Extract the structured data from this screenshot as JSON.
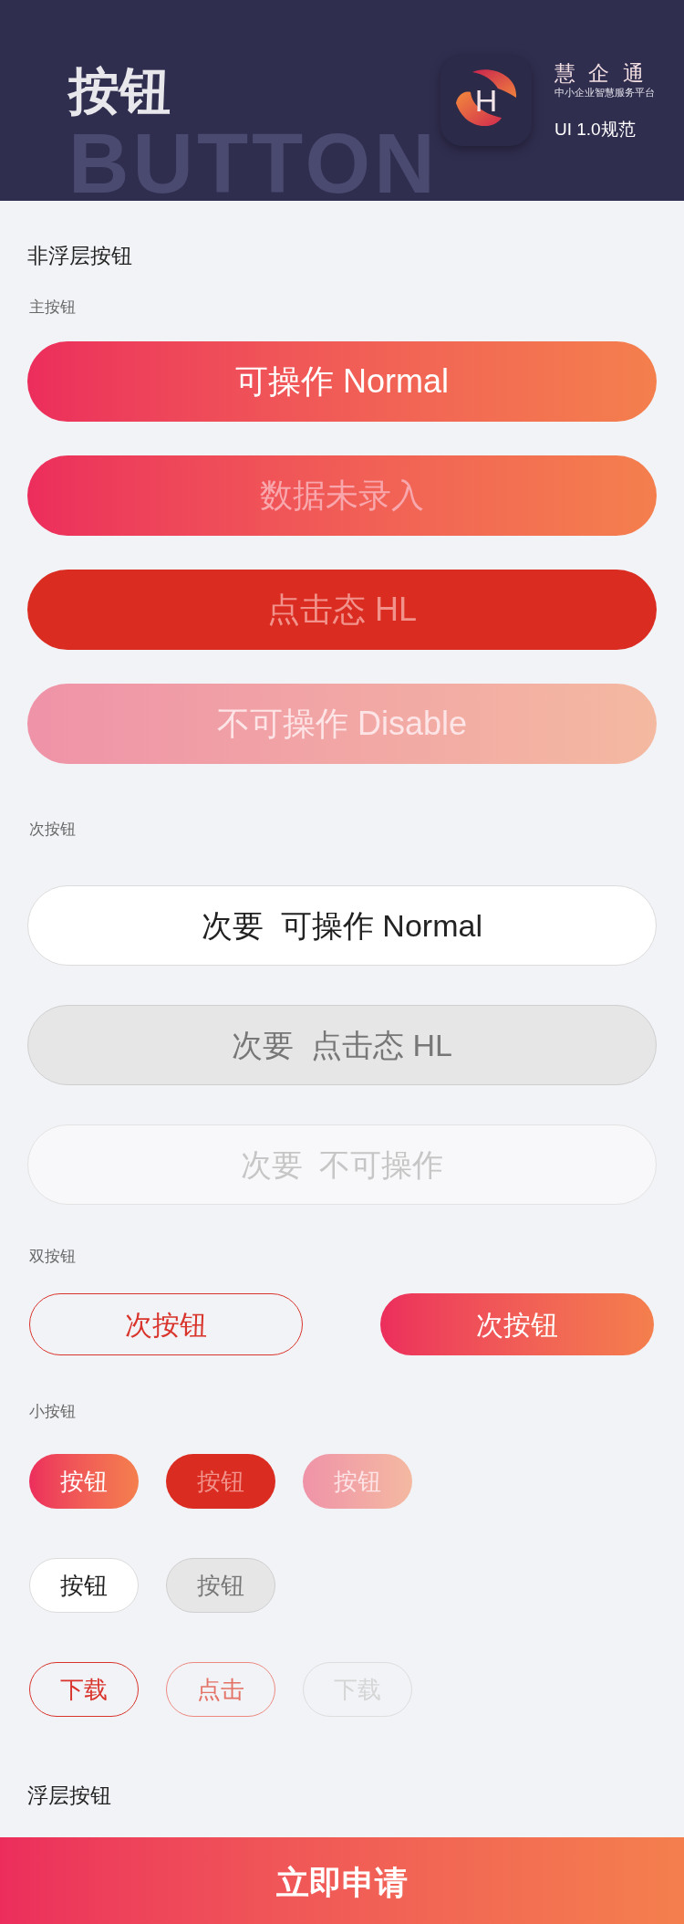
{
  "header": {
    "title": "按钮",
    "backdrop_word": "BUTTON",
    "logo_letter": "H",
    "brand": "慧 企 通",
    "slogan": "中小企业智慧服务平台",
    "version": "UI 1.0规范"
  },
  "non_floating": {
    "title": "非浮层按钮",
    "groups": [
      {
        "label": "主按钮",
        "kind": "primary",
        "rows": [
          [
            {
              "label": "可操作 Normal",
              "kind": "primary"
            }
          ],
          [
            {
              "label": "数据未录入",
              "kind": "primary-empty"
            }
          ],
          [
            {
              "label": "点击态 HL",
              "kind": "primary-pressed"
            }
          ],
          [
            {
              "label": "不可操作 Disable",
              "kind": "primary-disabled"
            }
          ]
        ]
      },
      {
        "label": "次按钮",
        "kind": "secondary",
        "rows": [
          [
            {
              "label": "次要  可操作 Normal",
              "kind": "secondary"
            }
          ],
          [
            {
              "label": "次要  点击态 HL",
              "kind": "secondary-pressed"
            }
          ],
          [
            {
              "label": "次要  不可操作",
              "kind": "secondary-disabled"
            }
          ]
        ]
      },
      {
        "label": "双按钮",
        "kind": "pair",
        "rows": [
          [
            {
              "label": "次按钮",
              "kind": "outline"
            },
            {
              "label": "次按钮",
              "kind": "primary"
            }
          ]
        ]
      },
      {
        "label": "小按钮",
        "kind": "small",
        "rows": [
          [
            {
              "label": "按钮",
              "kind": "primary"
            },
            {
              "label": "按钮",
              "kind": "primary-pressed"
            },
            {
              "label": "按钮",
              "kind": "primary-disabled"
            }
          ],
          [
            {
              "label": "按钮",
              "kind": "secondary"
            },
            {
              "label": "按钮",
              "kind": "secondary-pressed"
            }
          ],
          [
            {
              "label": "下载",
              "kind": "outline"
            },
            {
              "label": "点击",
              "kind": "outline-light"
            },
            {
              "label": "下载",
              "kind": "outline-disabled"
            }
          ]
        ]
      }
    ]
  },
  "floating": {
    "title": "浮层按钮",
    "button": "立即申请"
  }
}
